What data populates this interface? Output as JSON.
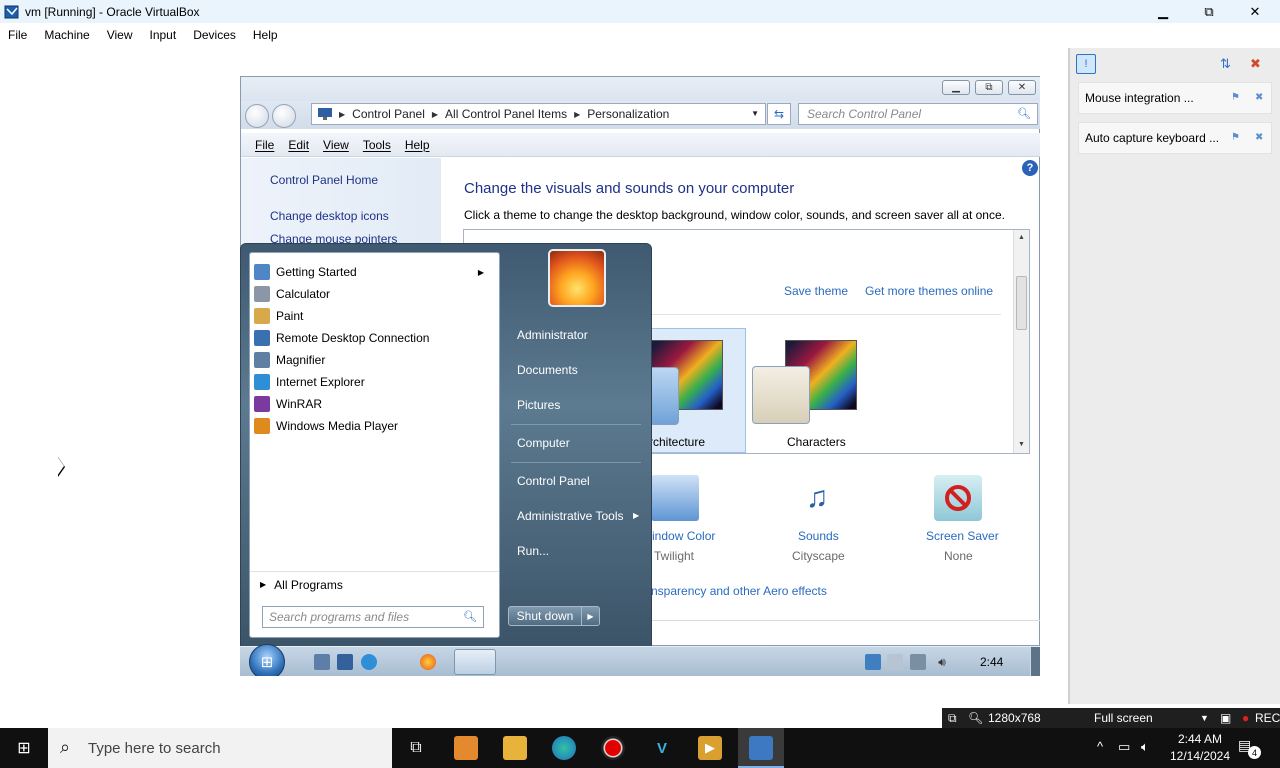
{
  "host_window": {
    "title": "vm [Running] - Oracle VirtualBox",
    "controls": {
      "minimize": "▁",
      "restore": "⧉",
      "close": "✕"
    },
    "menu": [
      "File",
      "Machine",
      "View",
      "Input",
      "Devices",
      "Help"
    ]
  },
  "control_panel": {
    "breadcrumb": [
      "Control Panel",
      "All Control Panel Items",
      "Personalization"
    ],
    "search_placeholder": "Search Control Panel",
    "menu": [
      "File",
      "Edit",
      "View",
      "Tools",
      "Help"
    ],
    "left_links": [
      "Control Panel Home",
      "Change desktop icons",
      "Change mouse pointers"
    ],
    "help_glyph": "?",
    "heading": "Change the visuals and sounds on your computer",
    "subheading": "Click a theme to change the desktop background, window color, sounds, and screen saver all at once.",
    "theme_links": {
      "save": "Save theme",
      "more": "Get more themes online"
    },
    "themes": [
      {
        "name": "Architecture",
        "visible_label": "rchitecture"
      },
      {
        "name": "Characters",
        "visible_label": "Characters"
      }
    ],
    "bottom_items": [
      {
        "label": "indow Color",
        "sub": "Twilight"
      },
      {
        "label": "Sounds",
        "sub": "Cityscape"
      },
      {
        "label": "Screen Saver",
        "sub": "None"
      }
    ],
    "aero_link": "nsparency and other Aero effects"
  },
  "start_menu": {
    "programs": [
      {
        "label": "Getting Started",
        "icon": "getting-started-icon",
        "color": "#4f86c6",
        "arrow": true
      },
      {
        "label": "Calculator",
        "icon": "calculator-icon",
        "color": "#8b97a6",
        "arrow": false
      },
      {
        "label": "Paint",
        "icon": "paint-icon",
        "color": "#d8a94a",
        "arrow": false
      },
      {
        "label": "Remote Desktop Connection",
        "icon": "remote-desktop-icon",
        "color": "#3a6fb0",
        "arrow": false
      },
      {
        "label": "Magnifier",
        "icon": "magnifier-icon",
        "color": "#5f7fa3",
        "arrow": false
      },
      {
        "label": "Internet Explorer",
        "icon": "internet-explorer-icon",
        "color": "#2f8fd6",
        "arrow": false
      },
      {
        "label": "WinRAR",
        "icon": "winrar-icon",
        "color": "#7a3aa0",
        "arrow": false
      },
      {
        "label": "Windows Media Player",
        "icon": "media-player-icon",
        "color": "#e08a1e",
        "arrow": false
      }
    ],
    "all_programs": "All Programs",
    "search_placeholder": "Search programs and files",
    "right_items": [
      "Administrator",
      "Documents",
      "Pictures",
      "Computer",
      "Control Panel",
      "Administrative Tools",
      "Run..."
    ],
    "shutdown": "Shut down"
  },
  "guest_taskbar": {
    "clock": "2:44"
  },
  "side_panel": {
    "notifications": [
      "Mouse integration ...",
      "Auto capture keyboard ..."
    ]
  },
  "vb_status": {
    "resolution": "1280x768",
    "mode": "Full screen",
    "rec": "REC"
  },
  "host_taskbar": {
    "search_placeholder": "Type here to search",
    "time": "2:44 AM",
    "date": "12/14/2024",
    "notification_count": "4"
  }
}
